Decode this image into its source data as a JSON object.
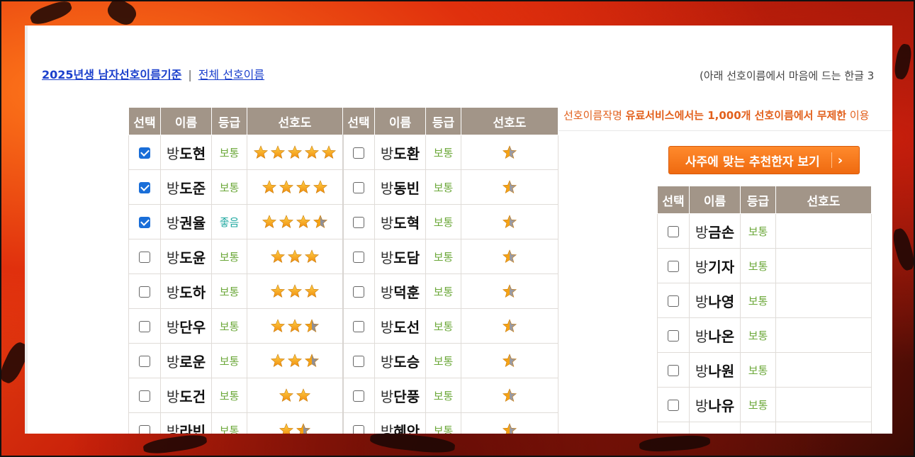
{
  "header": {
    "link_main": "2025년생 남자선호이름기준",
    "separator": "|",
    "link_all": "전체 선호이름",
    "hint": "(아래 선호이름에서 마음에 드는 한글 3"
  },
  "promo": {
    "prefix": "선호이름작명 ",
    "bold": "유료서비스에서는 1,000개 선호이름에서 무제한",
    "suffix": " 이용"
  },
  "recommend_button": {
    "label": "사주에 맞는 추천한자 보기",
    "icon": "chevron-right-icon"
  },
  "table_headers": [
    "선택",
    "이름",
    "등급",
    "선호도",
    "선택",
    "이름",
    "등급",
    "선호도"
  ],
  "right_table_headers": [
    "선택",
    "이름",
    "등급",
    "선호도"
  ],
  "colors": {
    "header_bg": "#a29588",
    "grade_normal": "#6ca83a",
    "grade_good": "#1fa8a0",
    "button": "#f37720",
    "promo": "#e2601c"
  },
  "left_rows": [
    {
      "checked": true,
      "surname": "방",
      "given": "도현",
      "grade": "보통",
      "stars": 5
    },
    {
      "checked": true,
      "surname": "방",
      "given": "도준",
      "grade": "보통",
      "stars": 4
    },
    {
      "checked": true,
      "surname": "방",
      "given": "권율",
      "grade": "좋음",
      "stars": 3.5
    },
    {
      "checked": false,
      "surname": "방",
      "given": "도윤",
      "grade": "보통",
      "stars": 3
    },
    {
      "checked": false,
      "surname": "방",
      "given": "도하",
      "grade": "보통",
      "stars": 3
    },
    {
      "checked": false,
      "surname": "방",
      "given": "단우",
      "grade": "보통",
      "stars": 2.5
    },
    {
      "checked": false,
      "surname": "방",
      "given": "로운",
      "grade": "보통",
      "stars": 2.5
    },
    {
      "checked": false,
      "surname": "방",
      "given": "도건",
      "grade": "보통",
      "stars": 2
    },
    {
      "checked": false,
      "surname": "방",
      "given": "라빈",
      "grade": "보통",
      "stars": 1.5
    }
  ],
  "middle_rows": [
    {
      "checked": false,
      "surname": "방",
      "given": "도환",
      "grade": "보통",
      "stars": 0.5
    },
    {
      "checked": false,
      "surname": "방",
      "given": "동빈",
      "grade": "보통",
      "stars": 0.5
    },
    {
      "checked": false,
      "surname": "방",
      "given": "도혁",
      "grade": "보통",
      "stars": 0.5
    },
    {
      "checked": false,
      "surname": "방",
      "given": "도담",
      "grade": "보통",
      "stars": 0.5
    },
    {
      "checked": false,
      "surname": "방",
      "given": "덕훈",
      "grade": "보통",
      "stars": 0.5
    },
    {
      "checked": false,
      "surname": "방",
      "given": "도선",
      "grade": "보통",
      "stars": 0.5
    },
    {
      "checked": false,
      "surname": "방",
      "given": "도승",
      "grade": "보통",
      "stars": 0.5
    },
    {
      "checked": false,
      "surname": "방",
      "given": "단풍",
      "grade": "보통",
      "stars": 0.5
    },
    {
      "checked": false,
      "surname": "방",
      "given": "혜안",
      "grade": "보통",
      "stars": 0.5
    }
  ],
  "right_rows": [
    {
      "checked": false,
      "surname": "방",
      "given": "금손",
      "grade": "보통"
    },
    {
      "checked": false,
      "surname": "방",
      "given": "기자",
      "grade": "보통"
    },
    {
      "checked": false,
      "surname": "방",
      "given": "나영",
      "grade": "보통"
    },
    {
      "checked": false,
      "surname": "방",
      "given": "나온",
      "grade": "보통"
    },
    {
      "checked": false,
      "surname": "방",
      "given": "나원",
      "grade": "보통"
    },
    {
      "checked": false,
      "surname": "방",
      "given": "나유",
      "grade": "보통"
    },
    {
      "checked": false,
      "surname": "",
      "given": "",
      "grade": ""
    }
  ]
}
